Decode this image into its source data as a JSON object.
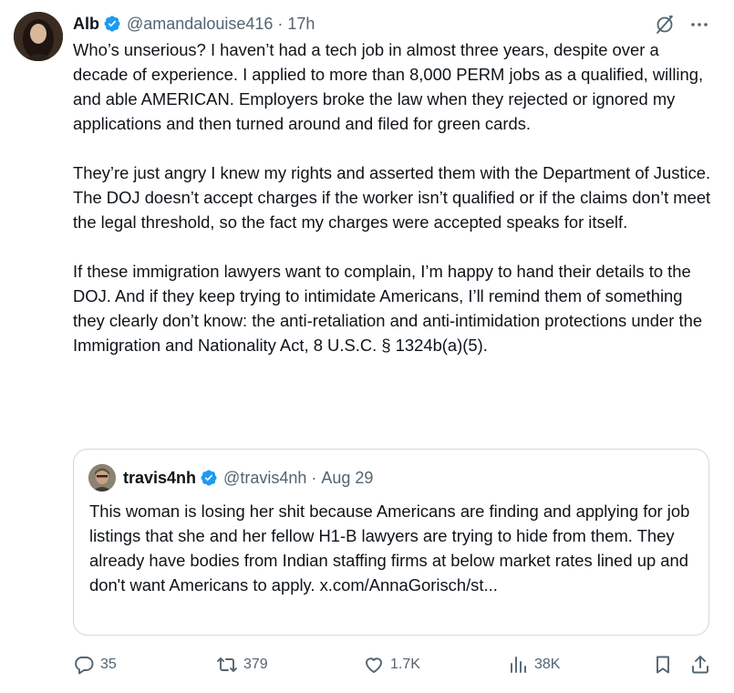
{
  "tweet": {
    "author_name": "Alb",
    "author_handle": "@amandalouise416",
    "separator": "·",
    "time": "17h",
    "paragraphs": [
      "Who’s unserious? I haven’t had a tech job in almost three years, despite over a decade of experience. I applied to more than 8,000 PERM jobs as a qualified, willing, and able AMERICAN. Employers broke the law when they rejected or ignored my applications and then turned around and filed for green cards.",
      "They’re just angry I knew my rights and asserted them with the Department of Justice. The DOJ doesn’t accept charges if the worker isn’t qualified or if the claims don’t meet the legal threshold, so the fact my charges were accepted speaks for itself.",
      "If these immigration lawyers want to complain, I’m happy to hand their details to the DOJ. And if they keep trying to intimidate Americans, I’ll remind them of something they clearly don’t know: the anti-retaliation and anti-intimidation protections under the Immigration and Nationality Act, 8 U.S.C. § 1324b(a)(5)."
    ]
  },
  "quote": {
    "author_name": "travis4nh",
    "author_handle": "@travis4nh",
    "separator": "·",
    "date": "Aug 29",
    "text": "This woman is losing her shit because Americans are finding and applying for job listings that she and her fellow H1-B lawyers are trying to hide from them. They already have bodies from Indian staffing firms at below market rates lined up and don't want Americans to apply. x.com/AnnaGorisch/st..."
  },
  "actions": {
    "replies": "35",
    "reposts": "379",
    "likes": "1.7K",
    "views": "38K"
  },
  "icons": {
    "verified": "verified-badge-icon",
    "grok": "grok-icon",
    "more": "more-icon",
    "reply": "reply-icon",
    "repost": "repost-icon",
    "like": "heart-icon",
    "views": "views-icon",
    "bookmark": "bookmark-icon",
    "share": "share-icon"
  },
  "colors": {
    "text": "#0f1419",
    "secondary": "#536471",
    "verified": "#1d9bf0",
    "border": "#cfd9de"
  }
}
